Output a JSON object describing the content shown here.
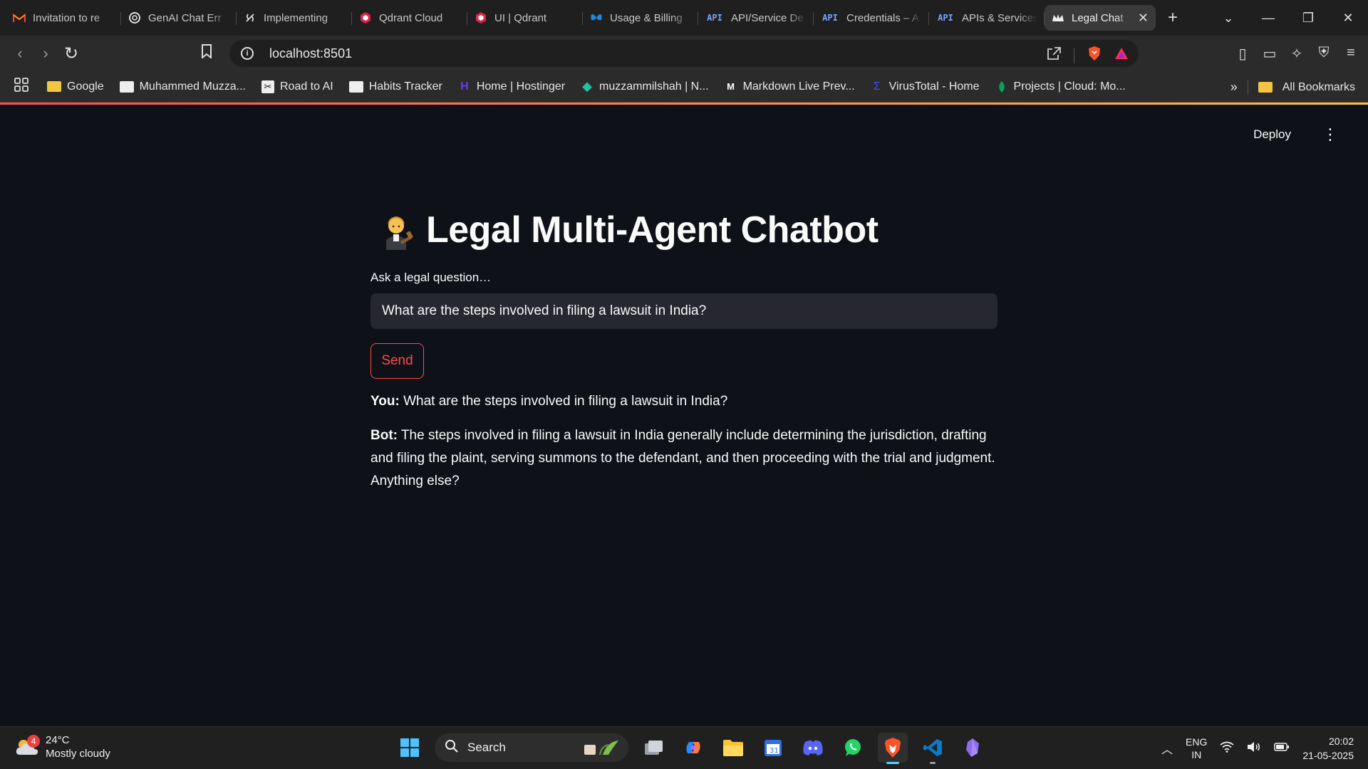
{
  "browser": {
    "tabs": [
      {
        "title": "Invitation to re",
        "favicon": "gmail-icon"
      },
      {
        "title": "GenAI Chat Err",
        "favicon": "openai-icon"
      },
      {
        "title": "Implementing",
        "favicon": "langchain-icon"
      },
      {
        "title": "Qdrant Cloud",
        "favicon": "qdrant-icon"
      },
      {
        "title": "UI | Qdrant",
        "favicon": "qdrant-icon"
      },
      {
        "title": "Usage & Billing",
        "favicon": "butterfly-icon"
      },
      {
        "title": "API/Service De",
        "favicon": "api-icon"
      },
      {
        "title": "Credentials – A",
        "favicon": "api-icon"
      },
      {
        "title": "APIs & Services",
        "favicon": "api-icon"
      },
      {
        "title": "Legal Chat",
        "favicon": "streamlit-crown-icon",
        "active": true
      }
    ],
    "api_favicon_text": "API",
    "url": "localhost:8501",
    "bookmarks": [
      {
        "label": "Google",
        "icon": "folder-icon"
      },
      {
        "label": "Muhammed Muzza...",
        "icon": "site-icon"
      },
      {
        "label": "Road to AI",
        "icon": "site-icon"
      },
      {
        "label": "Habits Tracker",
        "icon": "site-icon"
      },
      {
        "label": "Home | Hostinger",
        "icon": "hostinger-icon"
      },
      {
        "label": "muzzammilshah | N...",
        "icon": "diamond-icon"
      },
      {
        "label": "Markdown Live Prev...",
        "icon": "markdown-icon"
      },
      {
        "label": "VirusTotal - Home",
        "icon": "virustotal-icon"
      },
      {
        "label": "Projects | Cloud: Mo...",
        "icon": "mongodb-icon"
      }
    ],
    "all_bookmarks": "All Bookmarks"
  },
  "app": {
    "deploy_label": "Deploy",
    "title": "Legal Multi-Agent Chatbot",
    "question_label": "Ask a legal question…",
    "question_value": "What are the steps involved in filing a lawsuit in India?",
    "send_label": "Send",
    "messages": [
      {
        "speaker": "You:",
        "text": "What are the steps involved in filing a lawsuit in India?"
      },
      {
        "speaker": "Bot:",
        "text": "The steps involved in filing a lawsuit in India generally include determining the jurisdiction, drafting and filing the plaint, serving summons to the defendant, and then proceeding with the trial and judgment. Anything else?"
      }
    ]
  },
  "taskbar": {
    "weather_temp": "24°C",
    "weather_desc": "Mostly cloudy",
    "weather_badge": "4",
    "search_label": "Search",
    "lang_line1": "ENG",
    "lang_line2": "IN",
    "time": "20:02",
    "date": "21-05-2025"
  },
  "colors": {
    "accent": "#ff4b4b",
    "app_bg": "#0e1117",
    "input_bg": "#262730"
  }
}
